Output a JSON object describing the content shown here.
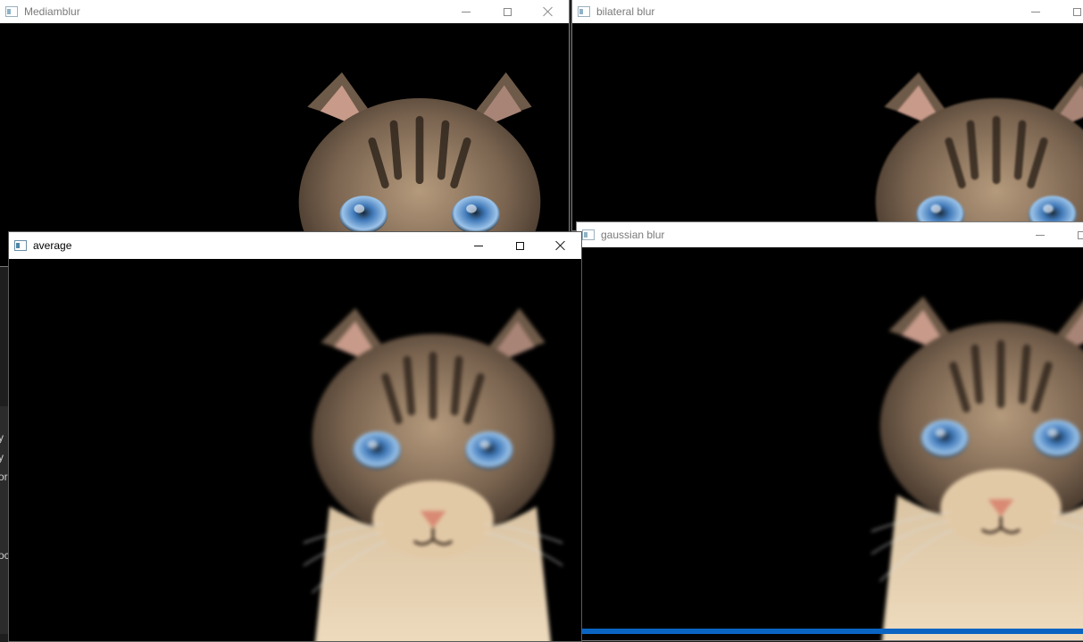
{
  "windows": {
    "mediamblur": {
      "title": "Mediamblur"
    },
    "bilateral": {
      "title": "bilateral blur"
    },
    "average": {
      "title": "average"
    },
    "gaussian": {
      "title": "gaussian blur"
    }
  },
  "controls": {
    "minimize_icon": "minimize-icon",
    "maximize_icon": "maximize-icon",
    "close_icon": "close-icon"
  },
  "background_app": {
    "fragments": [
      "y",
      "y",
      "or",
      "oc"
    ]
  },
  "colors": {
    "titlebar": "#ffffff",
    "image_bg": "#000000",
    "taskbar": "#0a64c2"
  }
}
